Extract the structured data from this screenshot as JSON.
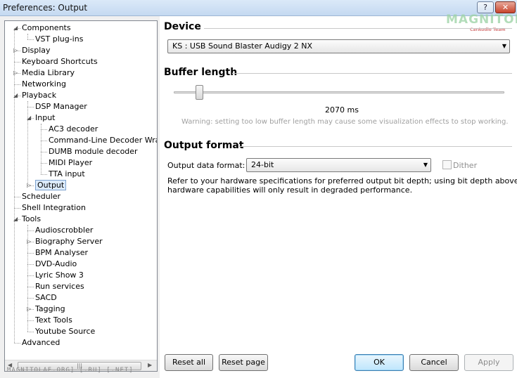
{
  "window": {
    "title": "Preferences: Output",
    "help_label": "?",
    "close_label": "✕",
    "watermark": "MAGNITOLA",
    "watermark_sub": "CarAudio Team",
    "bottom_watermark": "MAGNITOLAE.ORG] [.RU] [.NET]"
  },
  "tree": {
    "scroll_thumb_grip": "|||",
    "items": [
      {
        "label": "Components",
        "depth": 1,
        "expander": "open"
      },
      {
        "label": "VST plug-ins",
        "depth": 2,
        "expander": "none"
      },
      {
        "label": "Display",
        "depth": 1,
        "expander": "closed"
      },
      {
        "label": "Keyboard Shortcuts",
        "depth": 1,
        "expander": "none"
      },
      {
        "label": "Media Library",
        "depth": 1,
        "expander": "closed"
      },
      {
        "label": "Networking",
        "depth": 1,
        "expander": "none"
      },
      {
        "label": "Playback",
        "depth": 1,
        "expander": "open"
      },
      {
        "label": "DSP Manager",
        "depth": 2,
        "expander": "none"
      },
      {
        "label": "Input",
        "depth": 2,
        "expander": "open"
      },
      {
        "label": "AC3 decoder",
        "depth": 3,
        "expander": "none"
      },
      {
        "label": "Command-Line Decoder Wrapper",
        "depth": 3,
        "expander": "none"
      },
      {
        "label": "DUMB module decoder",
        "depth": 3,
        "expander": "none"
      },
      {
        "label": "MIDI Player",
        "depth": 3,
        "expander": "none"
      },
      {
        "label": "TTA input",
        "depth": 3,
        "expander": "none"
      },
      {
        "label": "Output",
        "depth": 2,
        "expander": "closed",
        "selected": true
      },
      {
        "label": "Scheduler",
        "depth": 1,
        "expander": "none"
      },
      {
        "label": "Shell Integration",
        "depth": 1,
        "expander": "none"
      },
      {
        "label": "Tools",
        "depth": 1,
        "expander": "open"
      },
      {
        "label": "Audioscrobbler",
        "depth": 2,
        "expander": "none"
      },
      {
        "label": "Biography Server",
        "depth": 2,
        "expander": "closed"
      },
      {
        "label": "BPM Analyser",
        "depth": 2,
        "expander": "none"
      },
      {
        "label": "DVD-Audio",
        "depth": 2,
        "expander": "none"
      },
      {
        "label": "Lyric Show 3",
        "depth": 2,
        "expander": "none"
      },
      {
        "label": "Run services",
        "depth": 2,
        "expander": "none"
      },
      {
        "label": "SACD",
        "depth": 2,
        "expander": "none"
      },
      {
        "label": "Tagging",
        "depth": 2,
        "expander": "closed"
      },
      {
        "label": "Text Tools",
        "depth": 2,
        "expander": "none"
      },
      {
        "label": "Youtube Source",
        "depth": 2,
        "expander": "none"
      },
      {
        "label": "Advanced",
        "depth": 1,
        "expander": "none"
      }
    ]
  },
  "device": {
    "heading": "Device",
    "selected": "KS : USB Sound Blaster Audigy 2 NX"
  },
  "buffer": {
    "heading": "Buffer length",
    "value_label": "2070 ms",
    "warning": "Warning: setting too low buffer length may cause some visualization effects to stop working."
  },
  "output_format": {
    "heading": "Output format",
    "depth_label": "Output data format:",
    "depth_selected": "24-bit",
    "dither_label": "Dither",
    "dither_checked": false,
    "note_line1": "Refer to your hardware specifications for preferred output bit depth; using bit depth above your",
    "note_line2": "hardware capabilities will only result in degraded performance."
  },
  "buttons": {
    "reset_all": "Reset all",
    "reset_page": "Reset page",
    "ok": "OK",
    "cancel": "Cancel",
    "apply": "Apply"
  },
  "icons": {
    "expander_open": "◢",
    "expander_closed": "▷",
    "dropdown": "▼",
    "scroll_left": "◀",
    "scroll_right": "▶"
  }
}
